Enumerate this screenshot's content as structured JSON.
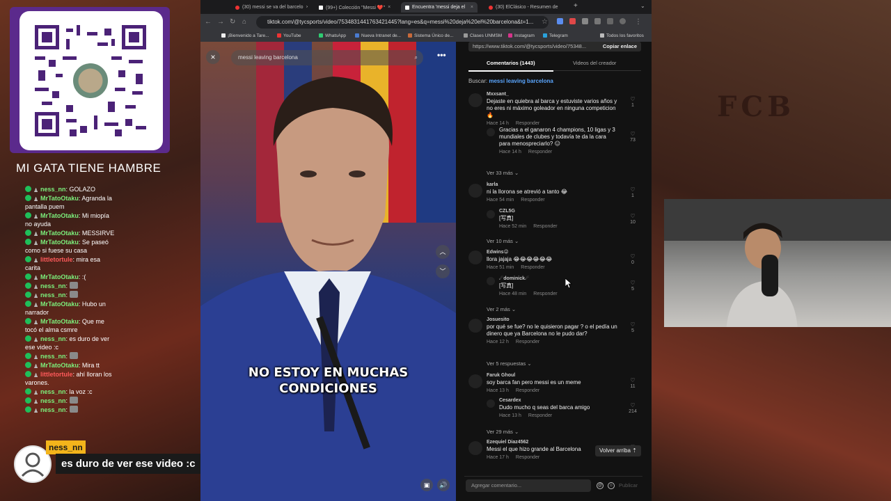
{
  "overlay": {
    "qr_caption": "MI GATA TIENE HAMBRE",
    "chat": [
      {
        "user": "ness_nn",
        "text": "GOLAZO",
        "color": "green",
        "emote": false
      },
      {
        "user": "MrTatoOtaku",
        "text": "Agranda la pantalla puem",
        "color": "green",
        "emote": false
      },
      {
        "user": "MrTatoOtaku",
        "text": "Mi miopía no ayuda",
        "color": "green",
        "emote": false
      },
      {
        "user": "MrTatoOtaku",
        "text": "MESSIRVE",
        "color": "green",
        "emote": false
      },
      {
        "user": "MrTatoOtaku",
        "text": "Se paseó como si fuese su casa",
        "color": "green",
        "emote": false
      },
      {
        "user": "littletortule",
        "text": "mira esa carita",
        "color": "red",
        "emote": false
      },
      {
        "user": "MrTatoOtaku",
        "text": ":(",
        "color": "green",
        "emote": false
      },
      {
        "user": "ness_nn",
        "text": "",
        "color": "green",
        "emote": true
      },
      {
        "user": "ness_nn",
        "text": "",
        "color": "green",
        "emote": true
      },
      {
        "user": "MrTatoOtaku",
        "text": "Hubo un narrador",
        "color": "green",
        "emote": false
      },
      {
        "user": "MrTatoOtaku",
        "text": "Que me tocó el alma csmre",
        "color": "green",
        "emote": false
      },
      {
        "user": "ness_nn",
        "text": "es duro de ver ese video :c",
        "color": "green",
        "emote": false
      },
      {
        "user": "ness_nn",
        "text": "",
        "color": "green",
        "emote": true
      },
      {
        "user": "MrTatoOtaku",
        "text": "Mira tt",
        "color": "green",
        "emote": false
      },
      {
        "user": "littletortule",
        "text": "ahí lloran los varones.",
        "color": "red",
        "emote": false
      },
      {
        "user": "ness_nn",
        "text": "la voz :c",
        "color": "green",
        "emote": false
      },
      {
        "user": "ness_nn",
        "text": "",
        "color": "green",
        "emote": true
      },
      {
        "user": "ness_nn",
        "text": "",
        "color": "green",
        "emote": true
      }
    ],
    "alert_name": "ness_nn",
    "alert_message": "es duro de ver ese video :c",
    "fcb": "FCB"
  },
  "browser": {
    "tabs": [
      {
        "title": "(30) messi se va del barcelo",
        "icon": "youtube"
      },
      {
        "title": "(99+) Colección \"Messi ❤️\"",
        "icon": "tiktok"
      },
      {
        "title": "Encuentra 'messi deja el",
        "icon": "tiktok",
        "active": true
      },
      {
        "title": "(30) ElClásico - Resumen de",
        "icon": "youtube"
      }
    ],
    "url": "tiktok.com/@tycsports/video/7534831441763421445?lang=es&q=messi%20deja%20el%20barcelona&t=1...",
    "bookmarks": [
      "¡Bienvenido a Tare...",
      "YouTube",
      "WhatsApp",
      "Nueva Intranet de...",
      "Sistema Único de...",
      "Clases UNMSM",
      "Instagram",
      "Telegram",
      "Todos los favoritos"
    ]
  },
  "video": {
    "search_text": "messi leaving barcelona",
    "caption_line1": "NO ESTOY EN MUCHAS",
    "caption_line2": "CONDICIONES"
  },
  "panel": {
    "link": "https://www.tiktok.com/@tycsports/video/75348...",
    "copy_label": "Copiar enlace",
    "tab_comments": "Comentarios (1443)",
    "tab_videos": "Videos del creador",
    "search_prefix": "Buscar:",
    "search_query": "messi leaving barcelona",
    "comments": [
      {
        "user": "Mxxsant_",
        "text": "Dejaste en quiebra al barca y estuviste varios años y no eres ni máximo goleador en ninguna competicion🔥",
        "time": "Hace 14 h",
        "reply": "Responder",
        "likes": "1"
      },
      {
        "user": "",
        "text": "Gracias a el ganaron 4 champions, 10 ligas y 3 mundiales de clubes y todavía te da la cara para menospreciarlo? 😑",
        "time": "Hace 14 h",
        "reply": "Responder",
        "likes": "73",
        "isReply": true
      },
      {
        "user": "karla",
        "text": "ni la llorona se atrevió a tanto 😂",
        "time": "Hace 54 min",
        "reply": "Responder",
        "likes": "1"
      },
      {
        "user": "CZL5G",
        "text": "[写真]",
        "time": "Hace 52 min",
        "reply": "Responder",
        "likes": "10",
        "isReply": true
      },
      {
        "user": "Edwins😜",
        "text": "llora jajaja 😂😂😂😂😂😂",
        "time": "Hace 51 min",
        "reply": "Responder",
        "likes": "0"
      },
      {
        "user": "☄dominick☄",
        "text": "[写真]",
        "time": "Hace 48 min",
        "reply": "Responder",
        "likes": "5",
        "isReply": true
      },
      {
        "user": "Josuesito",
        "text": "por qué se fue? no le quisieron pagar ? o el pedía un dinero que ya Barcelona no le pudo dar?",
        "time": "Hace 12 h",
        "reply": "Responder",
        "likes": "5"
      },
      {
        "user": "Faruk Ghoul",
        "text": "soy barca fan pero messi es un meme",
        "time": "Hace 13 h",
        "reply": "Responder",
        "likes": "11"
      },
      {
        "user": "Cesardex",
        "text": "Dudo mucho q seas del barca amigo",
        "time": "Hace 13 h",
        "reply": "Responder",
        "likes": "214",
        "isReply": true
      },
      {
        "user": "Ezequiel Diaz4562",
        "text": "Messi el que hizo grande al Barcelona",
        "time": "Hace 17 h",
        "reply": "Responder",
        "likes": "2938"
      }
    ],
    "more_links": [
      "Ver 33 más",
      "Ver 10 más",
      "Ver 2 más",
      "Ver 5 respuestas",
      "Ver 29 más"
    ],
    "back_top": "Volver arriba",
    "add_placeholder": "Agregar comentario...",
    "publish": "Publicar"
  }
}
